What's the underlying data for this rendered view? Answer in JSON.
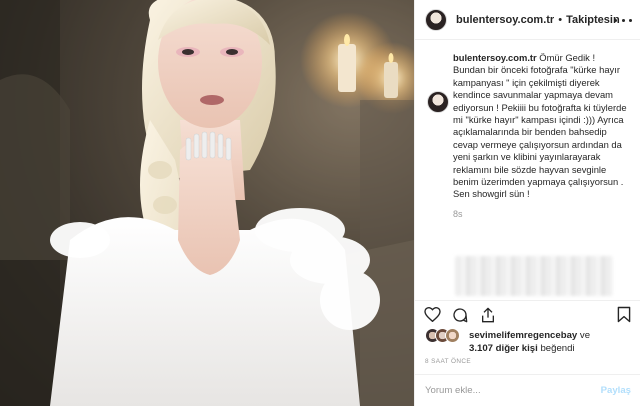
{
  "post": {
    "username": "bulentersoy.com.tr",
    "separator": "•",
    "follow_label": "Takiptesin",
    "icons": {
      "avatar": "profile-avatar",
      "more": "more-options-icon"
    }
  },
  "caption": {
    "username": "bulentersoy.com.tr",
    "text": " Ömür Gedik ! Bundan bir önceki fotoğrafa \"kürke hayır kampanyası \" için çekilmişti diyerek kendince savunmalar yapmaya devam ediyorsun ! Pekiiii bu fotoğrafta ki tüylerde mi \"kürke hayır\" kampası içindi :))) Ayrıca açıklamalarında bir benden bahsedip cevap vermeye çalışıyorsun ardından da yeni şarkın ve klibini yayınlarayarak reklamını bile sözde hayvan sevginle benim üzerimden yapmaya çalışıyorsun . Sen showgirl sün !",
    "age": "8s"
  },
  "actions": {
    "like": "heart-icon",
    "comment": "comment-icon",
    "share": "share-icon",
    "save": "bookmark-icon"
  },
  "likes": {
    "first_user": "sevimelifemregencebay",
    "conj": " ve",
    "count": "3.107 diğer kişi",
    "suffix": " beğendi"
  },
  "timestamp": "8 SAAT ÖNCE",
  "comment_box": {
    "placeholder": "Yorum ekle...",
    "post_label": "Paylaş"
  },
  "colors": {
    "text": "#262626",
    "muted": "#999999",
    "border": "#efefef",
    "post_button_disabled": "#b2dffc"
  }
}
